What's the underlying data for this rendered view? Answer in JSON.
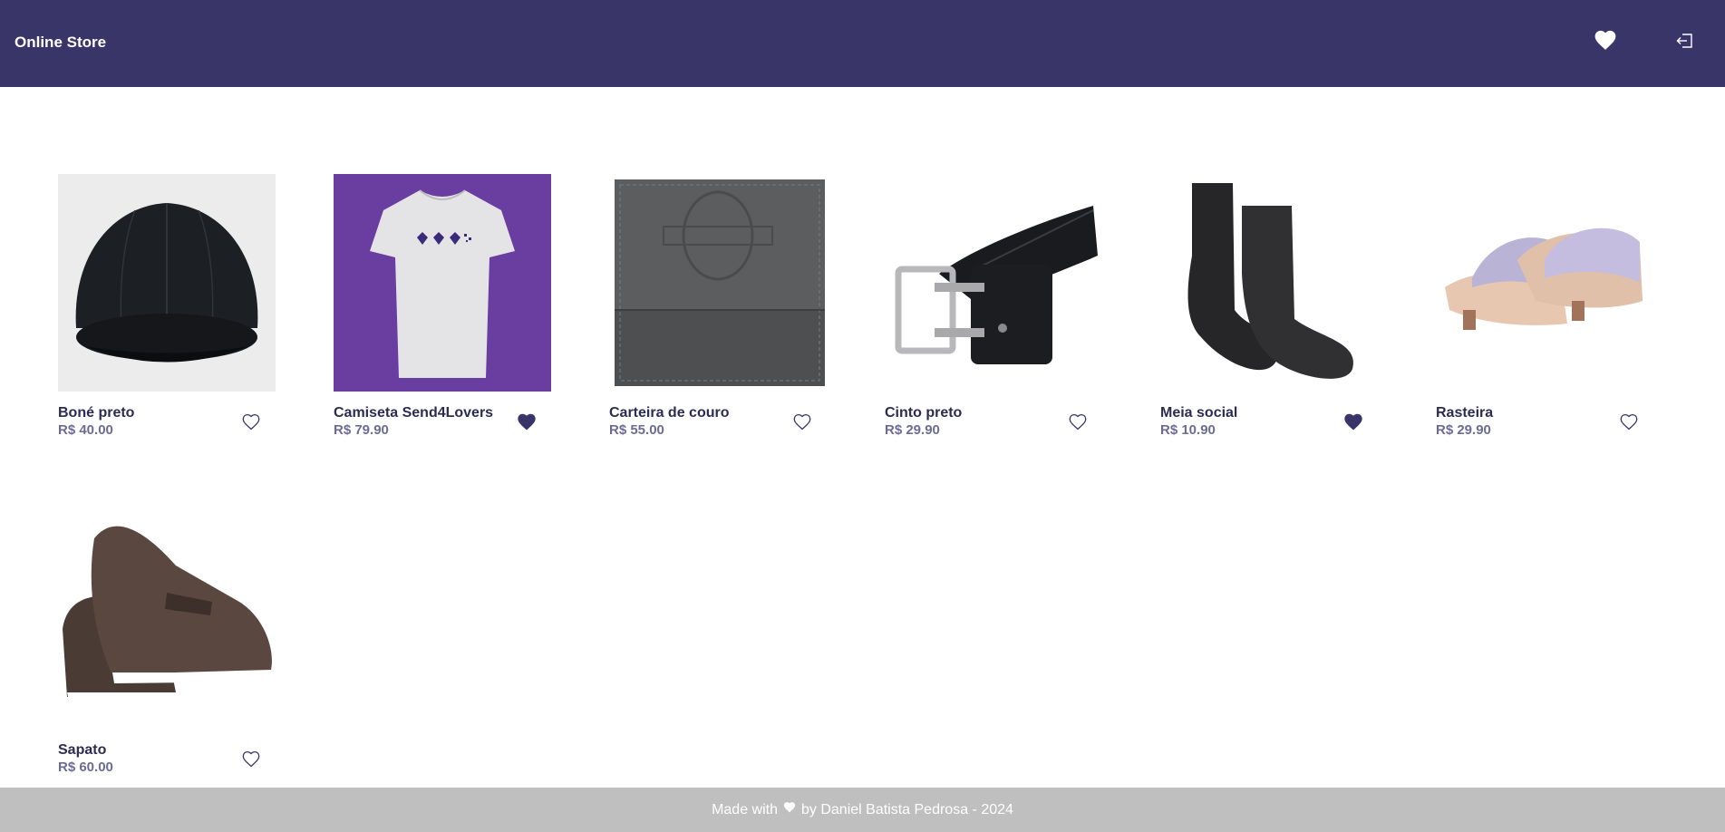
{
  "header": {
    "title": "Online Store",
    "favorites_icon": "heart-icon",
    "logout_icon": "logout-icon"
  },
  "products": [
    {
      "name": "Boné preto",
      "price": "R$ 40.00",
      "favorited": false,
      "image": "black-cap"
    },
    {
      "name": "Camiseta Send4Lovers",
      "price": "R$ 79.90",
      "favorited": true,
      "image": "white-tshirt-purple-bg"
    },
    {
      "name": "Carteira de couro",
      "price": "R$ 55.00",
      "favorited": false,
      "image": "grey-leather-wallet"
    },
    {
      "name": "Cinto preto",
      "price": "R$ 29.90",
      "favorited": false,
      "image": "black-belt"
    },
    {
      "name": "Meia social",
      "price": "R$ 10.90",
      "favorited": true,
      "image": "black-socks"
    },
    {
      "name": "Rasteira",
      "price": "R$ 29.90",
      "favorited": false,
      "image": "sandals"
    },
    {
      "name": "Sapato",
      "price": "R$ 60.00",
      "favorited": false,
      "image": "brown-shoes"
    }
  ],
  "footer": {
    "prefix": "Made with",
    "suffix": "by Daniel Batista Pedrosa - 2024",
    "heart_icon": "heart-icon"
  },
  "colors": {
    "header_bg": "#393569",
    "accent": "#393569",
    "footer_bg": "#bfbfbf",
    "price": "#6b6c96"
  }
}
